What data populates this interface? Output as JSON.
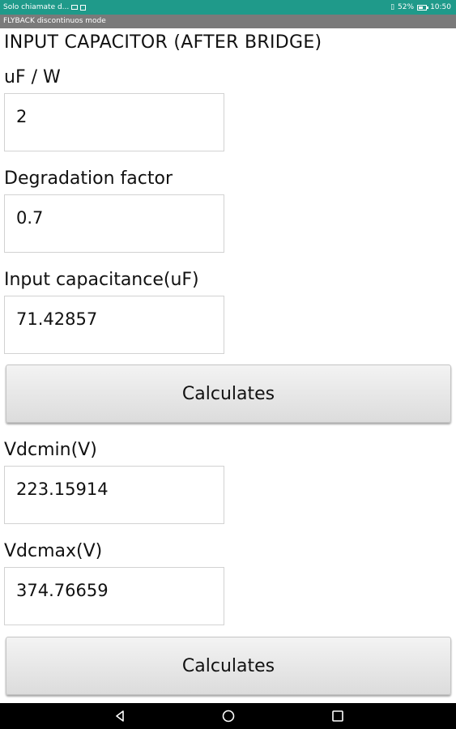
{
  "status_bar": {
    "notification_text": "Solo chiamate d...",
    "battery_percent": "52%",
    "time": "10:50"
  },
  "title_bar": {
    "app_title": "FLYBACK discontinuos mode"
  },
  "section": {
    "title": "INPUT CAPACITOR (AFTER BRIDGE)"
  },
  "fields": {
    "uf_per_w": {
      "label": "uF / W",
      "value": "2"
    },
    "degradation_factor": {
      "label": "Degradation factor",
      "value": "0.7"
    },
    "input_capacitance": {
      "label": "Input capacitance(uF)",
      "value": "71.42857"
    },
    "vdcmin": {
      "label": "Vdcmin(V)",
      "value": "223.15914"
    },
    "vdcmax": {
      "label": "Vdcmax(V)",
      "value": "374.76659"
    }
  },
  "buttons": {
    "calculate_1": "Calculates",
    "calculate_2": "Calculates"
  },
  "nav_bar": {
    "icons": [
      "back-icon",
      "home-icon",
      "recents-icon"
    ]
  },
  "colors": {
    "status_bar_bg": "#1f9a8a",
    "title_bar_bg": "#7a7a7a",
    "nav_bar_bg": "#000000"
  }
}
